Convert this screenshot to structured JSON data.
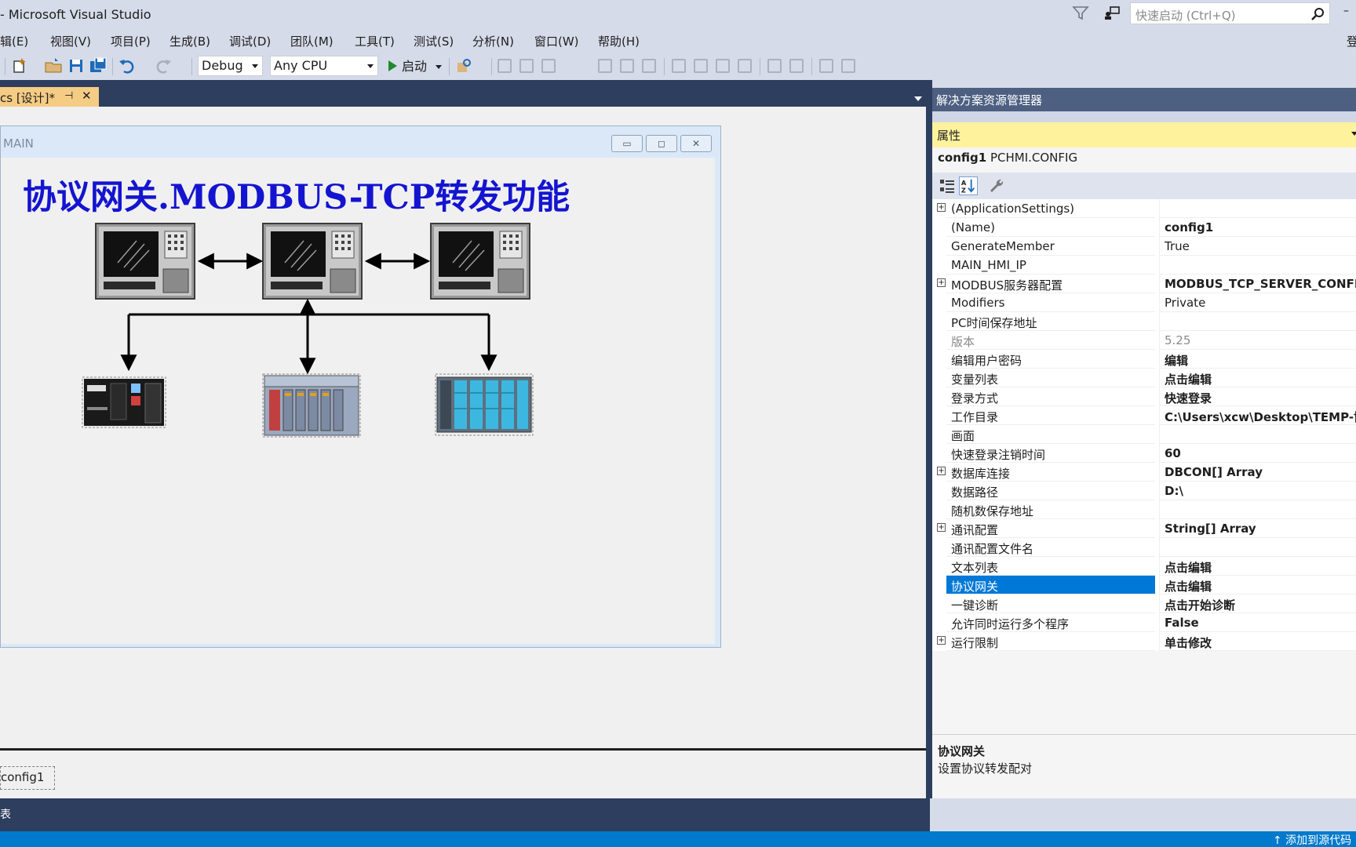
{
  "window": {
    "title": "- Microsoft Visual Studio"
  },
  "quick_launch": {
    "placeholder": "快速启动 (Ctrl+Q)"
  },
  "signin_label": "登",
  "menu": [
    "辑(E)",
    "视图(V)",
    "项目(P)",
    "生成(B)",
    "调试(D)",
    "团队(M)",
    "工具(T)",
    "测试(S)",
    "分析(N)",
    "窗口(W)",
    "帮助(H)"
  ],
  "toolbar": {
    "config": "Debug",
    "platform": "Any CPU",
    "start_label": "启动"
  },
  "doc_tab": {
    "label": "cs [设计]*",
    "pin_glyph": "⊣",
    "close_glyph": "✕"
  },
  "form": {
    "caption": "MAIN",
    "heading": "协议网关.MODBUS-TCP转发功能",
    "min_glyph": "▭",
    "max_glyph": "◻",
    "close_glyph": "✕"
  },
  "component_tray": {
    "item": "config1"
  },
  "bottom_band_label": "表",
  "statusbar": {
    "right_text": "↑ 添加到源代码"
  },
  "solution_explorer": {
    "title": "解决方案资源管理器"
  },
  "properties": {
    "header": "属性",
    "object_name": "config1",
    "object_type": "PCHMI.CONFIG",
    "rows": [
      {
        "name": "(ApplicationSettings)",
        "value": "",
        "expand": "+"
      },
      {
        "name": "(Name)",
        "value": "config1",
        "bold": true
      },
      {
        "name": "GenerateMember",
        "value": "True"
      },
      {
        "name": "MAIN_HMI_IP",
        "value": ""
      },
      {
        "name": "MODBUS服务器配置",
        "value": "MODBUS_TCP_SERVER_CONFIG[",
        "bold": true,
        "expand": "+"
      },
      {
        "name": "Modifiers",
        "value": "Private"
      },
      {
        "name": "PC时间保存地址",
        "value": ""
      },
      {
        "name": "版本",
        "value": "5.25",
        "dim": true
      },
      {
        "name": "编辑用户密码",
        "value": "编辑",
        "bold": true
      },
      {
        "name": "变量列表",
        "value": "点击编辑",
        "bold": true
      },
      {
        "name": "登录方式",
        "value": "快速登录",
        "bold": true
      },
      {
        "name": "工作目录",
        "value": "C:\\Users\\xcw\\Desktop\\TEMP-协",
        "bold": true
      },
      {
        "name": "画面",
        "value": ""
      },
      {
        "name": "快速登录注销时间",
        "value": "60",
        "bold": true
      },
      {
        "name": "数据库连接",
        "value": "DBCON[] Array",
        "bold": true,
        "expand": "+"
      },
      {
        "name": "数据路径",
        "value": "D:\\",
        "bold": true
      },
      {
        "name": "随机数保存地址",
        "value": ""
      },
      {
        "name": "通讯配置",
        "value": "String[] Array",
        "bold": true,
        "expand": "+"
      },
      {
        "name": "通讯配置文件名",
        "value": ""
      },
      {
        "name": "文本列表",
        "value": "点击编辑",
        "bold": true
      },
      {
        "name": "协议网关",
        "value": "点击编辑",
        "bold": true,
        "selected": true
      },
      {
        "name": "一键诊断",
        "value": "点击开始诊断",
        "bold": true
      },
      {
        "name": "允许同时运行多个程序",
        "value": "False",
        "bold": true
      },
      {
        "name": "运行限制",
        "value": "单击修改",
        "bold": true,
        "expand": "+"
      }
    ],
    "description_title": "协议网关",
    "description_text": "设置协议转发配对"
  }
}
